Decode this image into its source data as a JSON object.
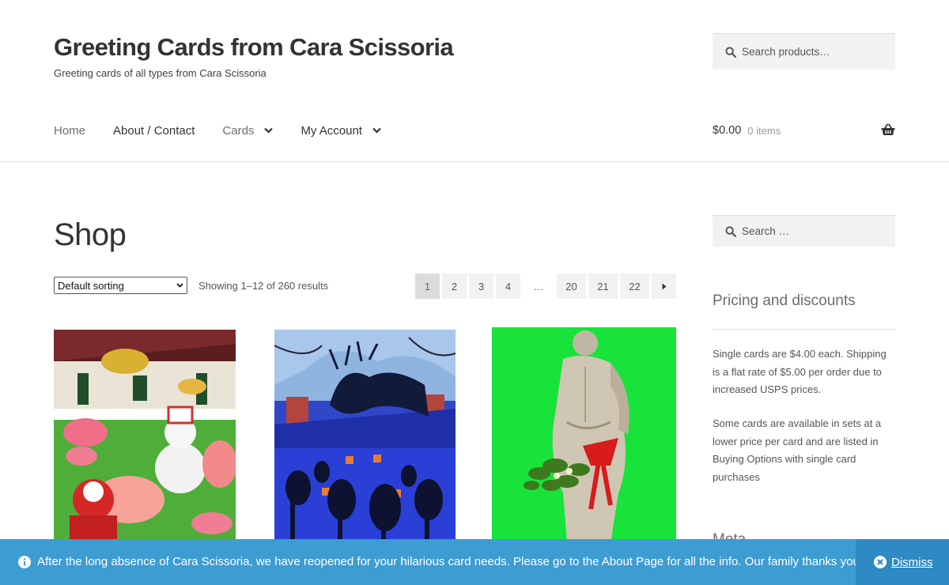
{
  "header": {
    "site_title": "Greeting Cards from Cara Scissoria",
    "tagline": "Greeting cards of all types from Cara Scissoria",
    "product_search_placeholder": "Search products…"
  },
  "nav": {
    "items": [
      {
        "label": "Home"
      },
      {
        "label": "About / Contact"
      },
      {
        "label": "Cards"
      },
      {
        "label": "My Account"
      }
    ]
  },
  "cart": {
    "amount": "$0.00",
    "count": "0 items"
  },
  "main": {
    "title": "Shop",
    "sorting_selected": "Default sorting",
    "result_count": "Showing 1–12 of 260 results",
    "pagination": [
      "1",
      "2",
      "3",
      "4",
      "…",
      "20",
      "21",
      "22"
    ],
    "products": [
      {
        "image_desc": "flamingos-santa-snowman-deer-card"
      },
      {
        "image_desc": "blue-house-deer-silhouette-card"
      },
      {
        "image_desc": "statue-mistletoe-green-card"
      }
    ]
  },
  "sidebar": {
    "search_placeholder": "Search …",
    "widget_title": "Pricing and discounts",
    "paragraph1": "Single cards are $4.00 each. Shipping is a flat rate of $5.00 per order due to increased USPS prices.",
    "paragraph2": "Some cards are available in sets at a lower price per card and are listed in Buying Options with single card purchases",
    "meta_title": "Meta"
  },
  "notice": {
    "message": "After the long absence of Cara Scissoria, we have reopened for your hilarious card needs. Please go to the About Page for all the info. Our family thanks you.",
    "dismiss_label": "Dismiss"
  },
  "colors": {
    "notice_bg": "#3d9cd2",
    "dismiss_bg": "#2e8ac2",
    "text": "#333333"
  }
}
